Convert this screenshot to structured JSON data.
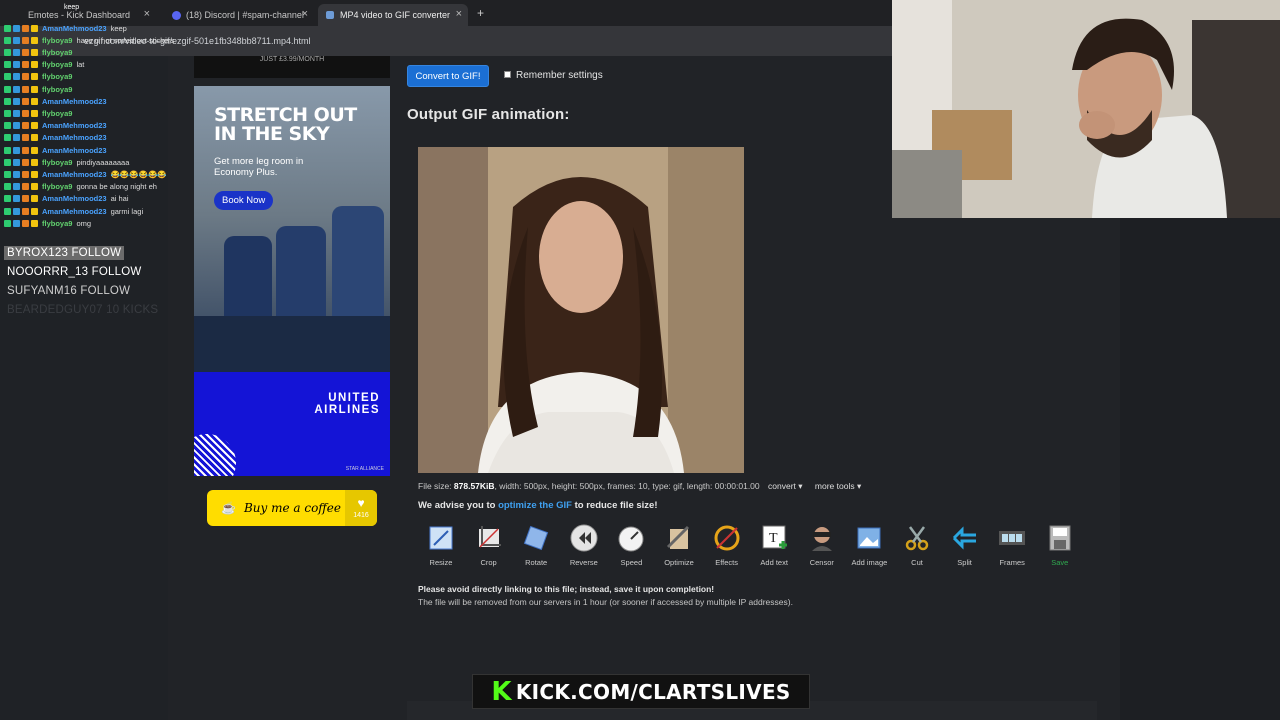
{
  "browser": {
    "tabs": [
      {
        "label": "Emotes - Kick Dashboard",
        "overlay": "keep"
      },
      {
        "label": "(18) Discord | #spam-channel"
      },
      {
        "label": "MP4 video to GIF converter"
      }
    ],
    "new_tab": "+",
    "url": "ezgif.com/video-to-gif/ezgif-501e1fb348bb8711.mp4.html"
  },
  "chat": [
    {
      "user": "AmanMehmood23",
      "msg": "keep",
      "color": "aman"
    },
    {
      "user": "flyboya9",
      "msg": "have u not sorted out stickers",
      "color": "fly"
    },
    {
      "user": "flyboya9",
      "msg": "",
      "color": "fly"
    },
    {
      "user": "flyboya9",
      "msg": "lat",
      "color": "fly"
    },
    {
      "user": "flyboya9",
      "msg": "",
      "color": "fly"
    },
    {
      "user": "flyboya9",
      "msg": "",
      "color": "fly"
    },
    {
      "user": "AmanMehmood23",
      "msg": "",
      "color": "aman"
    },
    {
      "user": "flyboya9",
      "msg": "",
      "color": "fly"
    },
    {
      "user": "AmanMehmood23",
      "msg": "",
      "color": "aman"
    },
    {
      "user": "AmanMehmood23",
      "msg": "",
      "color": "aman"
    },
    {
      "user": "AmanMehmood23",
      "msg": "",
      "color": "aman"
    },
    {
      "user": "flyboya9",
      "msg": "pindiyaaaaaaaa",
      "color": "fly"
    },
    {
      "user": "AmanMehmood23",
      "msg": "😂😂😂😂😂😂",
      "color": "aman"
    },
    {
      "user": "flyboya9",
      "msg": "gonna be along night eh",
      "color": "fly"
    },
    {
      "user": "AmanMehmood23",
      "msg": "ai hai",
      "color": "aman"
    },
    {
      "user": "AmanMehmood23",
      "msg": "garmi lagi",
      "color": "aman"
    },
    {
      "user": "flyboya9",
      "msg": "omg",
      "color": "fly"
    }
  ],
  "follows": [
    {
      "text": "BYROX123  FOLLOW",
      "active": true
    },
    {
      "text": "NOOORRR_13  FOLLOW",
      "active": false
    },
    {
      "text": "SUFYANM16  FOLLOW",
      "active": false
    },
    {
      "text": "BEARDEDGUY07  10 KICKS",
      "active": false
    }
  ],
  "ad": {
    "top_strip": "JUST £3.99/MONTH",
    "headline_1": "STRETCH OUT",
    "headline_2": "IN THE SKY",
    "subtext": "Get more leg room in Economy Plus.",
    "cta": "Book Now",
    "brand_1": "UNITED",
    "brand_2": "AIRLINES",
    "alliance": "STAR ALLIANCE"
  },
  "coffee": {
    "label": "Buy me a coffee",
    "count": "1416"
  },
  "converter": {
    "convert_label": "Convert to GIF!",
    "remember_label": "Remember settings",
    "output_heading": "Output GIF animation:",
    "file_size_label": "File size: ",
    "file_size": "878.57KiB",
    "file_details": ", width: 500px, height: 500px, frames: 10, type: gif, length: 00:00:01.00",
    "convert_menu": "convert ▾",
    "more_tools_menu": "more tools ▾",
    "advice_pre": "We advise you to ",
    "advice_link": "optimize the GIF",
    "advice_post": " to reduce file size!",
    "note_1": "Please avoid directly linking to this file; instead, save it upon completion!",
    "note_2": "The file will be removed from our servers in 1 hour (or sooner if accessed by multiple IP addresses)."
  },
  "tools": [
    {
      "label": "Resize",
      "icon": "resize-icon"
    },
    {
      "label": "Crop",
      "icon": "crop-icon"
    },
    {
      "label": "Rotate",
      "icon": "rotate-icon"
    },
    {
      "label": "Reverse",
      "icon": "reverse-icon"
    },
    {
      "label": "Speed",
      "icon": "speed-icon"
    },
    {
      "label": "Optimize",
      "icon": "optimize-icon"
    },
    {
      "label": "Effects",
      "icon": "effects-icon"
    },
    {
      "label": "Add text",
      "icon": "add-text-icon"
    },
    {
      "label": "Censor",
      "icon": "censor-icon"
    },
    {
      "label": "Add image",
      "icon": "add-image-icon"
    },
    {
      "label": "Cut",
      "icon": "cut-icon"
    },
    {
      "label": "Split",
      "icon": "split-icon"
    },
    {
      "label": "Frames",
      "icon": "frames-icon"
    },
    {
      "label": "Save",
      "icon": "save-icon"
    }
  ],
  "overlay": {
    "kick_url": "KICK.COM/CLARTSLIVES",
    "kick_logo": "K"
  },
  "colors": {
    "accent": "#1b6fd4",
    "link": "#3fa0f0",
    "kick_green": "#53fc18",
    "save_green": "#2fa84f"
  }
}
